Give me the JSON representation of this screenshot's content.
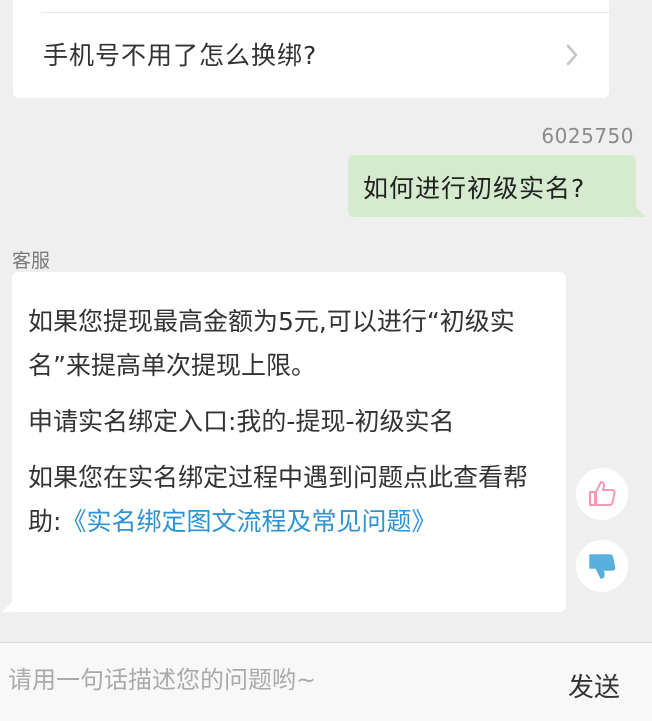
{
  "previous_card": {
    "faq_question": "手机号不用了怎么换绑?",
    "chevron_icon": "chevron-right-icon"
  },
  "user_message": {
    "user_id": "6025750",
    "text": "如何进行初级实名?"
  },
  "agent_message": {
    "sender_label": "客服",
    "para1": "如果您提现最高金额为5元,可以进行“初级实名”来提高单次提现上限。",
    "para2": "申请实名绑定入口:我的-提现-初级实名",
    "para3_prefix": "如果您在实名绑定过程中遇到问题点此查看帮助:",
    "para3_link": "《实名绑定图文流程及常见问题》"
  },
  "feedback": {
    "like_icon": "thumbs-up-icon",
    "dislike_icon": "thumbs-down-icon"
  },
  "input_bar": {
    "placeholder": "请用一句话描述您的问题哟~",
    "send_label": "发送"
  },
  "colors": {
    "background": "#efefef",
    "user_bubble": "#d5ebce",
    "link": "#2e93d0",
    "thumbs_up": "#f39ab2",
    "thumbs_down": "#5ab0dc"
  }
}
